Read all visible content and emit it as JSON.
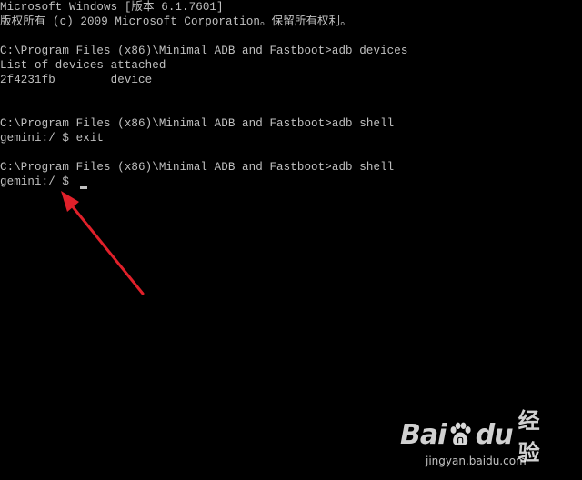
{
  "terminal": {
    "lines": [
      "Microsoft Windows [版本 6.1.7601]",
      "版权所有 (c) 2009 Microsoft Corporation。保留所有权利。",
      "",
      "C:\\Program Files (x86)\\Minimal ADB and Fastboot>adb devices",
      "List of devices attached",
      "2f4231fb        device",
      "",
      "",
      "C:\\Program Files (x86)\\Minimal ADB and Fastboot>adb shell",
      "gemini:/ $ exit",
      "",
      "C:\\Program Files (x86)\\Minimal ADB and Fastboot>adb shell",
      "gemini:/ $ "
    ],
    "text_color": "#c0c0c0",
    "background": "#000000"
  },
  "annotation": {
    "arrow_color": "#e0202a"
  },
  "watermark": {
    "brand_left": "Bai",
    "brand_right": "du",
    "suffix": "经验",
    "url": "jingyan.baidu.com",
    "paw_icon": "baidu-paw-icon"
  }
}
